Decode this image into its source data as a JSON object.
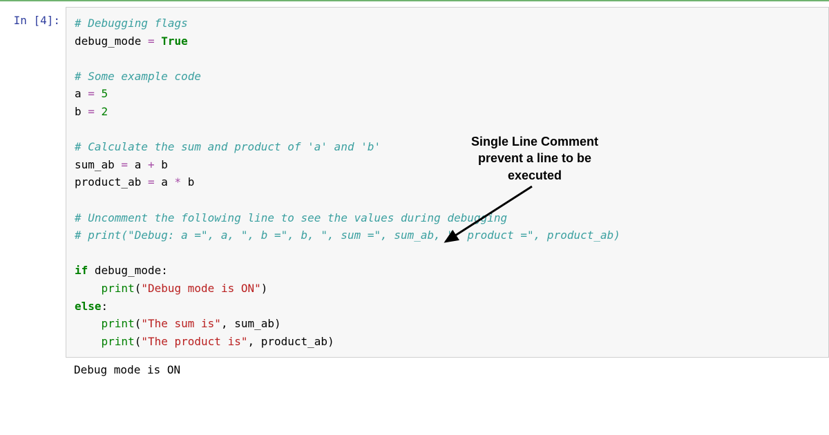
{
  "prompt": {
    "text": "In [4]:"
  },
  "code": {
    "l1_comment": "# Debugging flags",
    "l2_var": "debug_mode",
    "l2_op": " = ",
    "l2_val": "True",
    "l4_comment": "# Some example code",
    "l5_var": "a",
    "l5_op": " = ",
    "l5_val": "5",
    "l6_var": "b",
    "l6_op": " = ",
    "l6_val": "2",
    "l8_comment": "# Calculate the sum and product of 'a' and 'b'",
    "l9_var": "sum_ab",
    "l9_expr1": " = ",
    "l9_a": "a",
    "l9_plus": " + ",
    "l9_b": "b",
    "l10_var": "product_ab",
    "l10_eq": " = ",
    "l10_a": "a",
    "l10_star": " * ",
    "l10_b": "b",
    "l12_comment": "# Uncomment the following line to see the values during debugging",
    "l13_comment": "# print(\"Debug: a =\", a, \", b =\", b, \", sum =\", sum_ab, \", product =\", product_ab)",
    "l15_if": "if",
    "l15_cond": " debug_mode:",
    "l16_indent": "    ",
    "l16_print": "print",
    "l16_par_open": "(",
    "l16_str": "\"Debug mode is ON\"",
    "l16_par_close": ")",
    "l17_else": "else",
    "l17_colon": ":",
    "l18_indent": "    ",
    "l18_print": "print",
    "l18_par_open": "(",
    "l18_str": "\"The sum is\"",
    "l18_comma": ", sum_ab)",
    "l19_indent": "    ",
    "l19_print": "print",
    "l19_par_open": "(",
    "l19_str": "\"The product is\"",
    "l19_comma": ", product_ab)"
  },
  "output": {
    "text": "Debug mode is ON"
  },
  "annotation": {
    "line1": "Single Line Comment",
    "line2": "prevent a line to be",
    "line3": "executed"
  }
}
